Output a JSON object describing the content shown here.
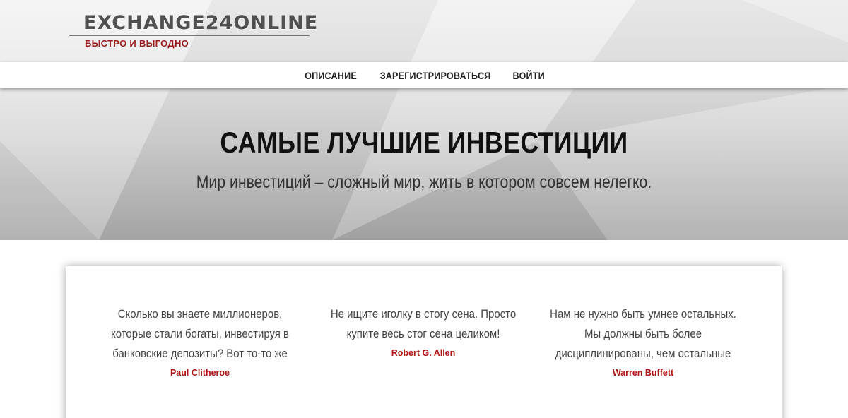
{
  "brand": {
    "title": "EXCHANGE24ONLINE",
    "tagline": "БЫСТРО И ВЫГОДНО"
  },
  "nav": {
    "items": [
      {
        "label": "ОПИСАНИЕ"
      },
      {
        "label": "ЗАРЕГИСТРИРОВАТЬСЯ"
      },
      {
        "label": "ВОЙТИ"
      }
    ]
  },
  "hero": {
    "title": "САМЫЕ ЛУЧШИЕ ИНВЕСТИЦИИ",
    "subtitle": "Мир инвестиций – сложный мир, жить в котором совсем нелегко."
  },
  "quotes": [
    {
      "text": "Сколько вы знаете миллионеров, которые стали богаты, инвестируя в банковские депозиты? Вот то-то же",
      "author": "Paul Clitheroe"
    },
    {
      "text": "Не ищите иголку в стогу сена. Просто купите весь стог сена целиком!",
      "author": "Robert G. Allen"
    },
    {
      "text": "Нам не нужно быть умнее остальных. Мы должны быть более дисциплинированы, чем остальные",
      "author": "Warren Buffett"
    }
  ],
  "colors": {
    "accent": "#b01515",
    "tagline": "#9b1c1c",
    "text": "#444444"
  }
}
